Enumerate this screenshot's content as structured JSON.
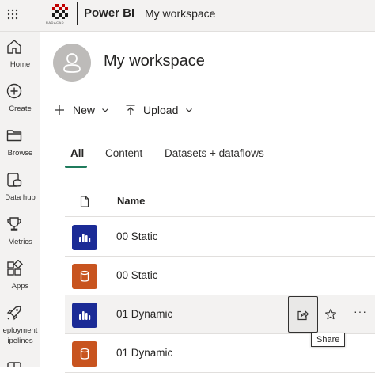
{
  "colors": {
    "report_tile": "#1b2b96",
    "dataset_tile": "#c8541f",
    "accent": "#1f7b5c"
  },
  "topbar": {
    "logo_caption": "RADACAD",
    "app_name": "Power BI",
    "breadcrumb": "My workspace"
  },
  "rail": {
    "items": [
      {
        "label": "Home",
        "icon": "home-icon"
      },
      {
        "label": "Create",
        "icon": "plus-circle-icon"
      },
      {
        "label": "Browse",
        "icon": "folder-icon"
      },
      {
        "label": "Data hub",
        "icon": "data-hub-icon"
      },
      {
        "label": "Metrics",
        "icon": "trophy-icon"
      },
      {
        "label": "Apps",
        "icon": "apps-icon"
      },
      {
        "label": "Deployment pipelines",
        "label_lines": [
          "eployment",
          "ipelines"
        ],
        "icon": "rocket-icon"
      }
    ]
  },
  "header": {
    "title": "My workspace"
  },
  "commands": {
    "new_label": "New",
    "upload_label": "Upload"
  },
  "tabs": [
    {
      "label": "All",
      "active": true
    },
    {
      "label": "Content",
      "active": false
    },
    {
      "label": "Datasets + dataflows",
      "active": false
    }
  ],
  "table": {
    "name_header": "Name",
    "rows": [
      {
        "name": "00 Static",
        "type": "report"
      },
      {
        "name": "00 Static",
        "type": "dataset"
      },
      {
        "name": "01 Dynamic",
        "type": "report",
        "hovered": true
      },
      {
        "name": "01 Dynamic",
        "type": "dataset"
      }
    ]
  },
  "tooltip": {
    "text": "Share"
  }
}
